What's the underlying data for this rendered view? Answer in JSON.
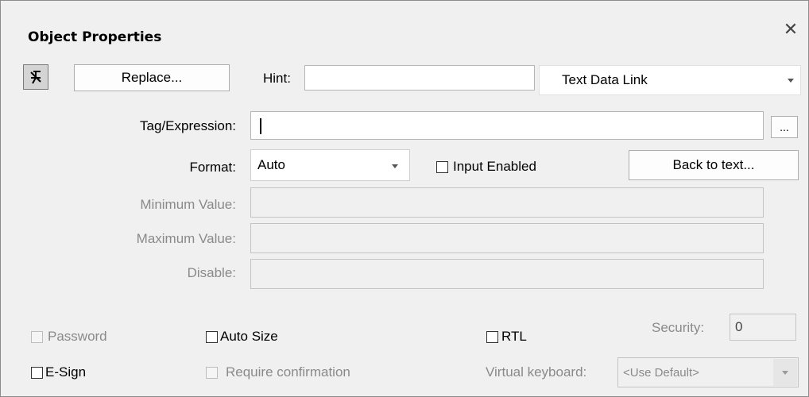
{
  "dialog": {
    "title": "Object Properties",
    "close_icon": "close-icon"
  },
  "toolbar": {
    "pin_icon": "pin-icon",
    "replace_label": "Replace...",
    "hint_label": "Hint:",
    "hint_value": "",
    "type_selected": "Text Data Link"
  },
  "fields": {
    "tag_label": "Tag/Expression:",
    "tag_value": "",
    "browse_label": "...",
    "format_label": "Format:",
    "format_selected": "Auto",
    "input_enabled_label": "Input Enabled",
    "back_to_text_label": "Back to text...",
    "min_label": "Minimum Value:",
    "max_label": "Maximum Value:",
    "disable_label": "Disable:"
  },
  "options": {
    "password_label": "Password",
    "auto_size_label": "Auto Size",
    "rtl_label": "RTL",
    "security_label": "Security:",
    "security_value": "0",
    "esign_label": "E-Sign",
    "require_confirmation_label": "Require confirmation",
    "virtual_keyboard_label": "Virtual keyboard:",
    "virtual_keyboard_selected": "<Use Default>"
  }
}
